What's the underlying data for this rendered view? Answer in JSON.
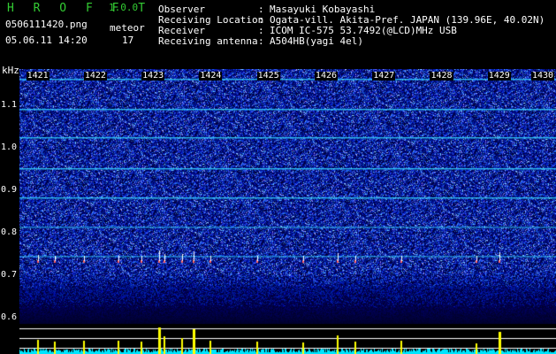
{
  "header": {
    "app_title": "H R O F F T",
    "app_version": "1.0.0",
    "file_name": "0506111420.png",
    "datetime": "05.06.11 14:20",
    "meteor_label": "meteor",
    "meteor_count": "17"
  },
  "station_info": [
    {
      "key": "Observer",
      "value": "Masayuki Kobayashi"
    },
    {
      "key": "Receiving Location",
      "value": "Ogata-vill. Akita-Pref. JAPAN (139.96E, 40.02N)"
    },
    {
      "key": "Receiver",
      "value": "ICOM IC-575 53.7492(@LCD)MHz USB"
    },
    {
      "key": "Receiving antenna",
      "value": "A504HB(yagi 4el)"
    }
  ],
  "separator": ":",
  "chart_data": {
    "type": "heatmap",
    "ylabel": "kHz",
    "x_ticks": [
      "1421",
      "1422",
      "1423",
      "1424",
      "1425",
      "1426",
      "1427",
      "1428",
      "1429",
      "1430"
    ],
    "x_range": [
      1420.7,
      1430.0
    ],
    "y_ticks": [
      "1.1",
      "1.0",
      "0.9",
      "0.8",
      "0.7",
      "0.6"
    ],
    "y_tick_values": [
      1.1,
      1.0,
      0.9,
      0.8,
      0.7,
      0.6
    ],
    "y_range": [
      0.585,
      1.185
    ],
    "carrier_lines_khz": [
      1.163,
      1.092,
      1.024,
      0.952,
      0.883,
      0.814,
      0.745
    ],
    "meteor_times": [
      1421.0,
      1421.3,
      1421.8,
      1422.4,
      1422.8,
      1423.1,
      1423.2,
      1423.5,
      1423.7,
      1424.0,
      1424.8,
      1425.6,
      1426.2,
      1426.5,
      1427.3,
      1428.6,
      1429.0
    ],
    "meteor_peaks": [
      0.35,
      0.25,
      0.3,
      0.3,
      0.28,
      1.0,
      0.55,
      0.45,
      0.9,
      0.3,
      0.25,
      0.22,
      0.6,
      0.25,
      0.3,
      0.2,
      0.75
    ],
    "colors": {
      "background": "#000000",
      "noise_low": "#00007a",
      "noise_high": "#4f7dff",
      "carrier": "#33d6ff",
      "meteor_echo": "#ff6060",
      "plot_baseline": "#ffffff",
      "plot_fill": "#00e5ff",
      "plot_peak": "#ffff00"
    }
  }
}
